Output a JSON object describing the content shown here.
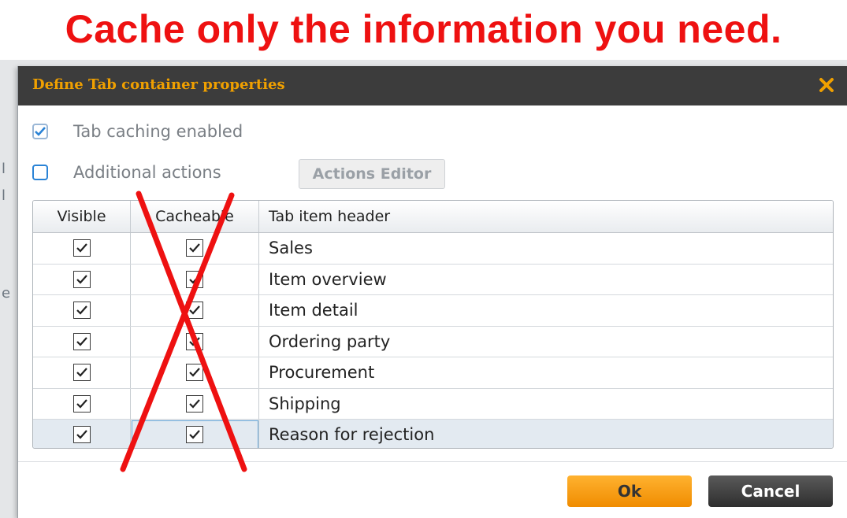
{
  "headline": "Cache only the information you need.",
  "dialog": {
    "title": "Define Tab container properties",
    "close_icon": "close-icon",
    "tab_caching": {
      "label": "Tab caching enabled",
      "checked": true
    },
    "additional_actions": {
      "label": "Additional actions",
      "checked": false
    },
    "actions_editor_label": "Actions Editor",
    "grid": {
      "headers": [
        "Visible",
        "Cacheable",
        "Tab item header"
      ],
      "rows": [
        {
          "visible": true,
          "cacheable": true,
          "header": "Sales"
        },
        {
          "visible": true,
          "cacheable": true,
          "header": "Item overview"
        },
        {
          "visible": true,
          "cacheable": true,
          "header": "Item detail"
        },
        {
          "visible": true,
          "cacheable": true,
          "header": "Ordering party"
        },
        {
          "visible": true,
          "cacheable": true,
          "header": "Procurement"
        },
        {
          "visible": true,
          "cacheable": true,
          "header": "Shipping"
        },
        {
          "visible": true,
          "cacheable": true,
          "header": "Reason for rejection"
        }
      ]
    },
    "ok_label": "Ok",
    "cancel_label": "Cancel"
  },
  "colors": {
    "headline": "#ee1111",
    "title": "#f0a000",
    "titlebar": "#3c3c3c",
    "ok": "#f7a21a",
    "cancel": "#3a3a3a",
    "cross": "#ee1111",
    "checkbox_accent": "#2a83d6"
  }
}
